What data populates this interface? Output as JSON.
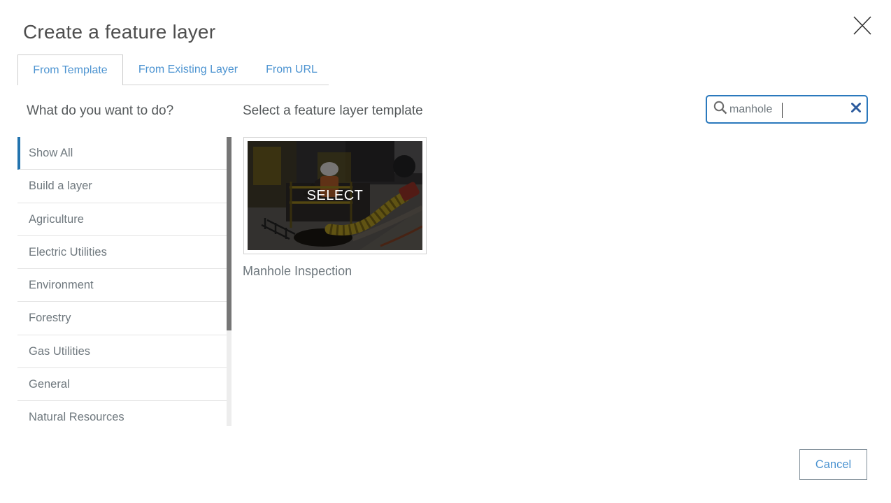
{
  "dialog": {
    "title": "Create a feature layer"
  },
  "tabs": [
    {
      "label": "From Template",
      "active": true
    },
    {
      "label": "From Existing Layer",
      "active": false
    },
    {
      "label": "From URL",
      "active": false
    }
  ],
  "left_panel": {
    "heading": "What do you want to do?",
    "selected_category": "Show All",
    "categories": [
      "Show All",
      "Build a layer",
      "Agriculture",
      "Electric Utilities",
      "Environment",
      "Forestry",
      "Gas Utilities",
      "General",
      "Natural Resources"
    ]
  },
  "templates_panel": {
    "heading": "Select a feature layer template",
    "search_value": "manhole",
    "card": {
      "overlay_label": "SELECT",
      "title": "Manhole Inspection"
    }
  },
  "footer": {
    "cancel_label": "Cancel"
  },
  "colors": {
    "accent_blue": "#4d94d1",
    "search_border_blue": "#2b79bd",
    "selected_bar_blue": "#2273ae",
    "clear_icon_blue": "#2d5c9e",
    "heading_gray": "#55595b",
    "list_text_gray": "#6f787e"
  }
}
